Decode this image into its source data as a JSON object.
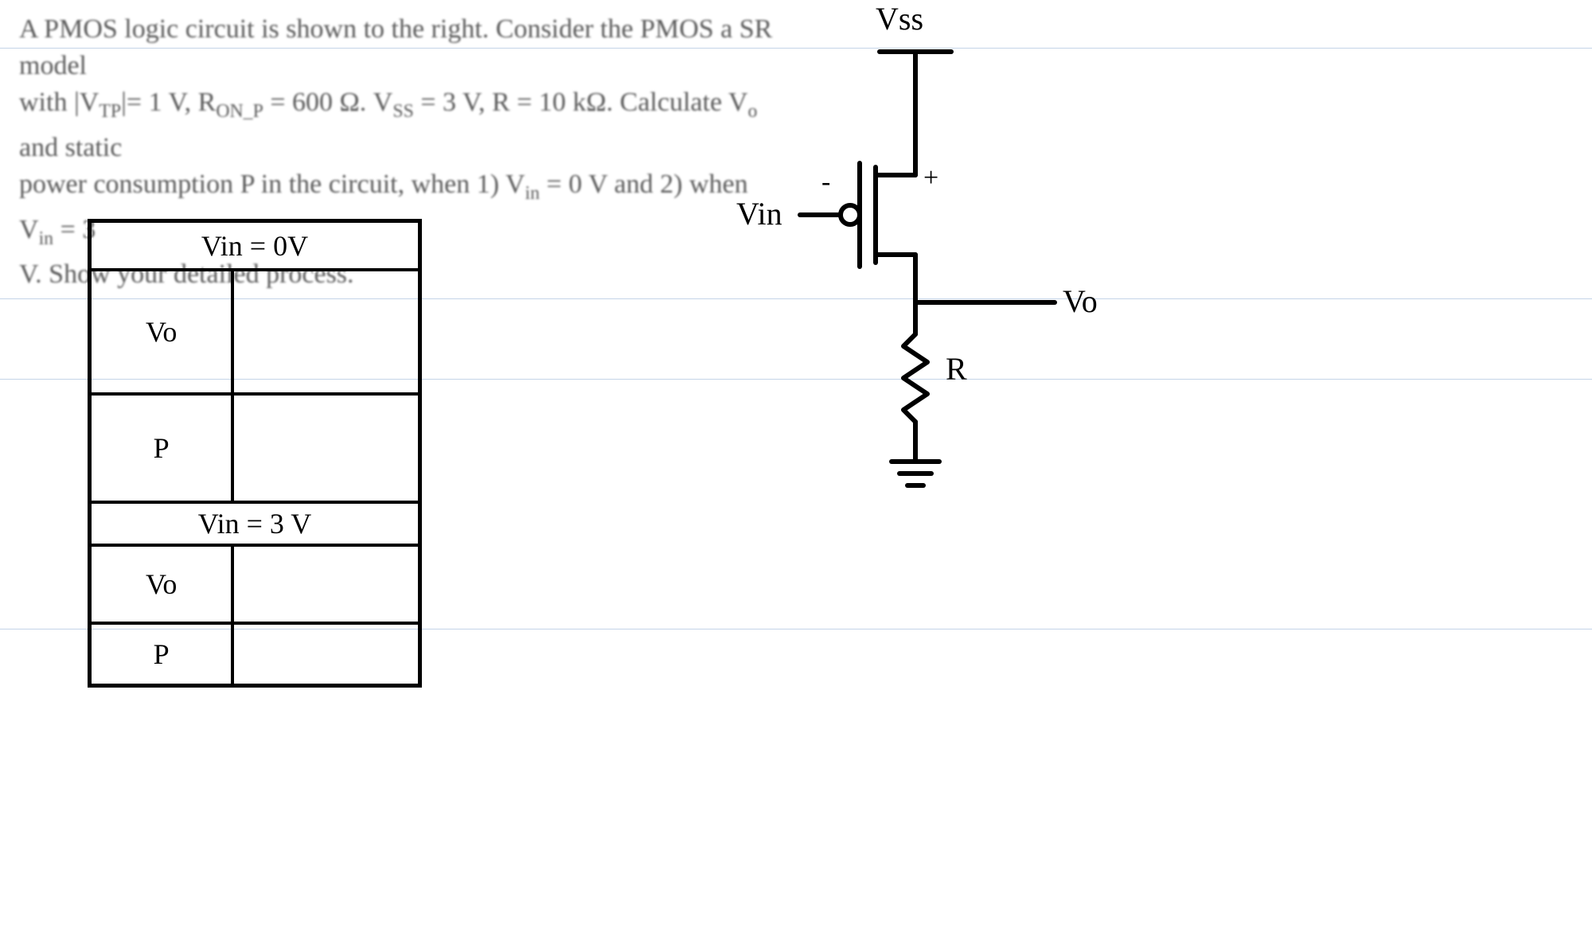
{
  "problem": {
    "line1_a": "A PMOS logic circuit is shown to the right. Consider the PMOS a SR model",
    "line2_a": "with |V",
    "line2_sub1": "TP",
    "line2_b": "|= 1 V, R",
    "line2_sub2": "ON_P",
    "line2_c": " = 600 Ω. V",
    "line2_sub3": "SS",
    "line2_d": " = 3 V, R = 10 kΩ. Calculate V",
    "line2_sub4": "o",
    "line2_e": " and static",
    "line3_a": "power consumption P in the circuit, when 1) V",
    "line3_sub1": "in",
    "line3_b": " = 0 V and 2) when V",
    "line3_sub2": "in",
    "line3_c": " = 3",
    "line4_a": "V. Show your detailed process."
  },
  "table": {
    "hdr1": "Vin = 0V",
    "r1c1": "Vo",
    "r1c2": "",
    "r2c1": "P",
    "r2c2": "",
    "hdr2": "Vin = 3 V",
    "r3c1": "Vo",
    "r3c2": "",
    "r4c1": "P",
    "r4c2": ""
  },
  "circuit": {
    "vss": "Vss",
    "vin": "Vin",
    "vo": "Vo",
    "r": "R",
    "plus": "+",
    "minus": "-"
  }
}
